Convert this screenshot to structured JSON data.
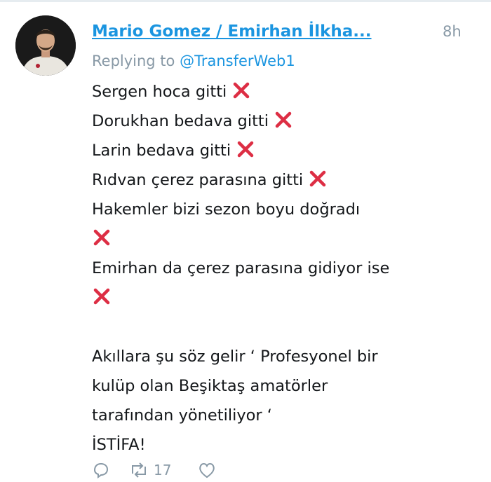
{
  "tweet": {
    "author": "Mario Gomez / Emirhan İlkha...",
    "time": "8h",
    "replying_prefix": "Replying to",
    "replying_handle": "@TransferWeb1",
    "lines": [
      "Sergen hoca gitti",
      "Dorukhan bedava gitti",
      "Larin bedava gitti",
      "Rıdvan çerez parasına gitti",
      "Hakemler bizi sezon boyu doğradı",
      "Emirhan da çerez parasına gidiyor ise",
      "Akıllara şu söz gelir ‘ Profesyonel bir",
      "kulüp olan Beşiktaş amatörler",
      "tarafından yönetiliyor ‘",
      "İSTİFA!"
    ],
    "reply_count": "",
    "retweet_count": "17"
  },
  "colors": {
    "link": "#1b95e0",
    "muted": "#8899a6",
    "text": "#14171a",
    "cross_mark": "#dd2e44"
  },
  "icons": {
    "cross": "cross-mark-emoji",
    "reply": "reply-icon",
    "retweet": "retweet-icon",
    "like": "like-icon"
  }
}
